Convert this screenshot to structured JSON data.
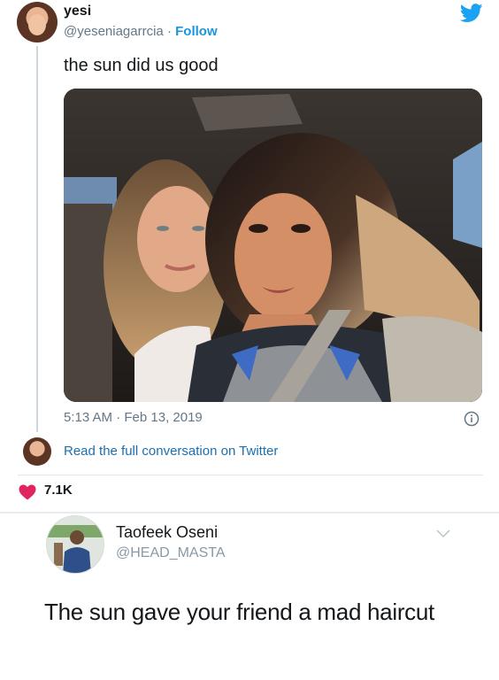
{
  "tweet": {
    "name": "yesi",
    "handle": "@yeseniagarrcia",
    "separator": "·",
    "follow_label": "Follow",
    "text": "the sun did us good",
    "timestamp": "5:13 AM · Feb 13, 2019",
    "read_conversation_label": "Read the full conversation on Twitter",
    "likes": "7.1K"
  },
  "reply": {
    "name": "Taofeek Oseni",
    "handle": "@HEAD_MASTA",
    "text": "The sun gave your friend a mad haircut"
  },
  "colors": {
    "twitter_blue": "#1da1f2",
    "link_blue": "#1b6fb0",
    "heart_red": "#e0245e"
  },
  "icons": [
    "twitter-bird-icon",
    "info-icon",
    "heart-icon",
    "chevron-down-icon"
  ]
}
